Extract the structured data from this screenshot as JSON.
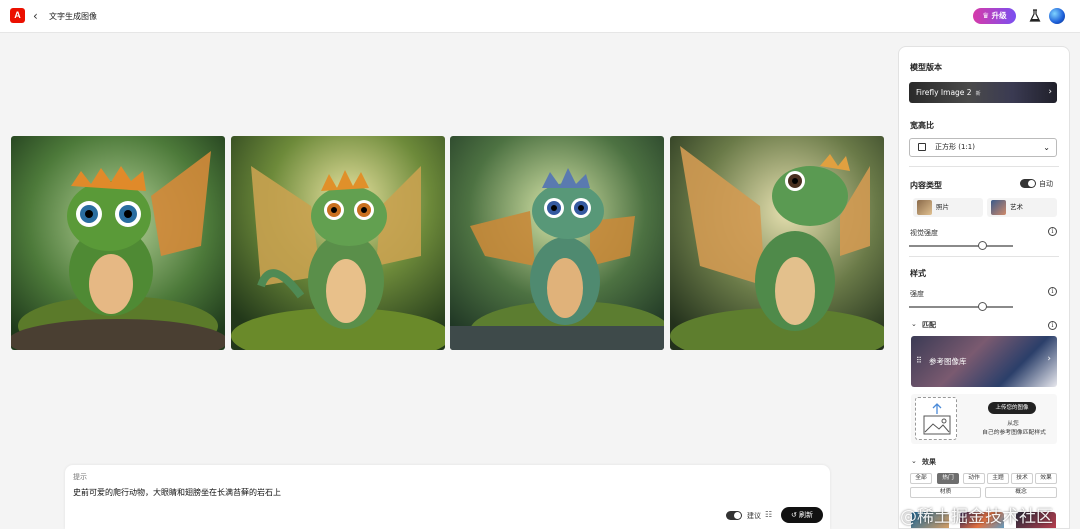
{
  "app": {
    "logo_icon": "adobe-logo-icon",
    "logo_glyph": "A",
    "back_icon": "chevron-left-icon",
    "back_glyph": "‹",
    "title": "文字生成图像",
    "upgrade_label": "升级",
    "upgrade_icon": "crown-icon",
    "upgrade_icon_glyph": "♛",
    "labs_icon": "flask-icon",
    "avatar_icon": "user-avatar-icon",
    "brand_color": "#eb1000"
  },
  "images": {
    "count": 4,
    "subject_icon": "dragon-image"
  },
  "prompt": {
    "label": "提示",
    "text": "史前可爱的爬行动物，大眼睛和翅膀坐在长满苔藓的岩石上",
    "suggest_label": "建议",
    "suggest_icon": "suggestions-icon",
    "suggest_glyph": "☷",
    "refresh_label": "刷新",
    "refresh_icon": "refresh-icon",
    "refresh_glyph": "↺"
  },
  "panel": {
    "model_heading": "模型版本",
    "model_value": "Firefly Image 2",
    "model_tag": "新",
    "model_chevron": "›",
    "ratio_heading": "宽高比",
    "ratio_value": "正方形 (1:1)",
    "ratio_chevron": "⌄",
    "content_heading": "内容类型",
    "auto_label": "自动",
    "content_options": [
      "照片",
      "艺术"
    ],
    "visual_intensity_label": "视觉强度",
    "visual_intensity_value": 0.71,
    "style_heading": "样式",
    "strength_label": "强度",
    "strength_value": 0.71,
    "info_glyph": "i",
    "match_heading": "匹配",
    "match_chevron": "⌄",
    "ref_gallery_label": "参考图像库",
    "ref_gallery_icon": "grid-icon",
    "ref_gallery_glyph": "⠿",
    "ref_gallery_chevron": "›",
    "upload_button": "上传您的图像",
    "upload_from": "从您",
    "upload_desc": "自己的参考图像匹配样式",
    "effects_heading": "效果",
    "effects_chevron": "⌄",
    "effect_tabs": [
      "全部",
      "热门",
      "动作",
      "主题",
      "技术",
      "效果",
      "材质",
      "概念"
    ],
    "selected_effect": "热门"
  },
  "watermark": "@稀土掘金技术社区"
}
